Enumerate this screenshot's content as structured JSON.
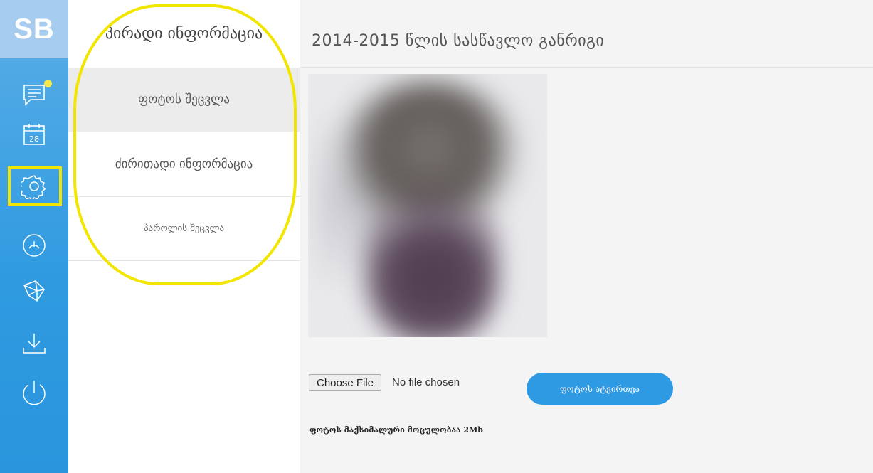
{
  "logo": "SB",
  "rail": {
    "icons": [
      {
        "name": "messages-icon"
      },
      {
        "name": "calendar-icon",
        "text": "28"
      },
      {
        "name": "settings-icon"
      },
      {
        "name": "dashboard-gauge-icon"
      },
      {
        "name": "origami-icon"
      },
      {
        "name": "download-icon"
      },
      {
        "name": "power-icon"
      }
    ],
    "accent": "#2f9ae0",
    "highlight_color": "#f2e600"
  },
  "submenu": {
    "items": [
      {
        "label": "პირადი ინფორმაცია"
      },
      {
        "label": "ფოტოს შეცვლა",
        "active": true
      },
      {
        "label": "ძირითადი ინფორმაცია"
      },
      {
        "label": "პაროლის შეცვლა"
      }
    ]
  },
  "main": {
    "title": "2014-2015 წლის სასწავლო განრიგი",
    "file_input": {
      "button": "Choose File",
      "status": "No file chosen"
    },
    "upload_button": "ფოტოს ატვირთვა",
    "note": "ფოტოს მაქსიმალური მოცულობაა 2Mb"
  }
}
